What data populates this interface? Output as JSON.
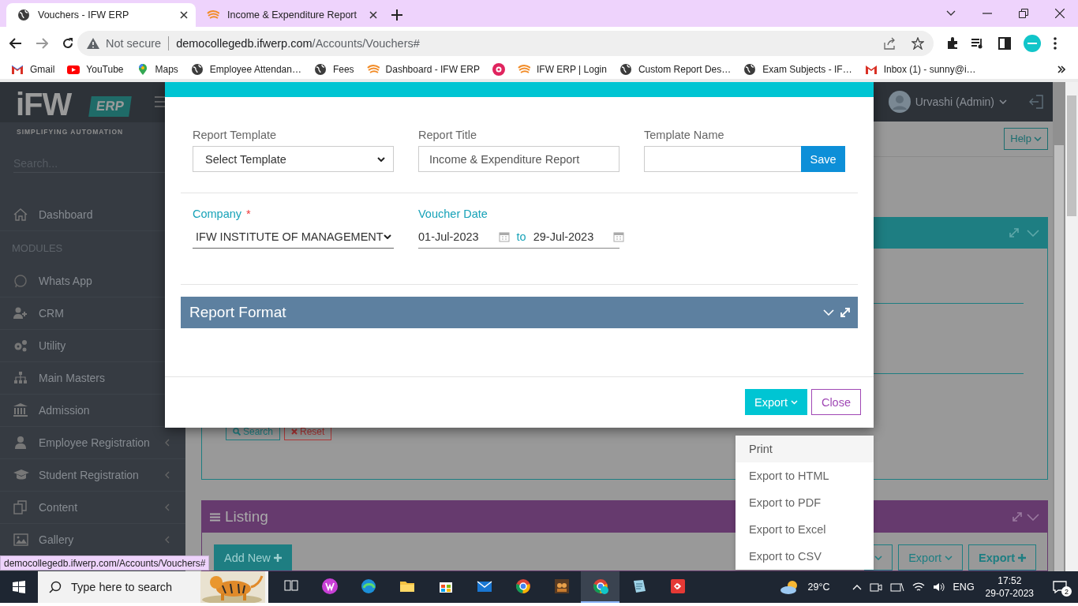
{
  "browser": {
    "tabs": [
      {
        "title": "Vouchers - IFW ERP",
        "selected": true
      },
      {
        "title": "Income & Expenditure Report",
        "selected": false
      }
    ],
    "address": {
      "security": "Not secure",
      "host": "democollegedb.ifwerp.com",
      "path": "/Accounts/Vouchers#"
    },
    "bookmarks": [
      {
        "kind": "link",
        "label": "Gmail"
      },
      {
        "kind": "link",
        "label": "YouTube"
      },
      {
        "kind": "link",
        "label": "Maps"
      },
      {
        "kind": "link",
        "label": "Employee Attendan…"
      },
      {
        "kind": "link",
        "label": "Fees"
      },
      {
        "kind": "link",
        "label": "Dashboard - IFW ERP"
      },
      {
        "kind": "icon"
      },
      {
        "kind": "link",
        "label": "IFW ERP | Login"
      },
      {
        "kind": "link",
        "label": "Custom Report Des…"
      },
      {
        "kind": "link",
        "label": "Exam Subjects - IF…"
      },
      {
        "kind": "link",
        "label": "Inbox (1) - sunny@i…"
      }
    ],
    "status_url": "democollegedb.ifwerp.com/Accounts/Vouchers#"
  },
  "app": {
    "logo": {
      "mark": "iFW",
      "badge": "ERP",
      "tagline": "SIMPLIFYING AUTOMATION"
    },
    "sidebar": {
      "search_placeholder": "Search...",
      "items": [
        {
          "kind": "item",
          "label": "Dashboard"
        },
        {
          "kind": "heading",
          "label": "MODULES"
        },
        {
          "kind": "item",
          "label": "Whats App"
        },
        {
          "kind": "item",
          "label": "CRM"
        },
        {
          "kind": "item",
          "label": "Utility"
        },
        {
          "kind": "item",
          "label": "Main Masters"
        },
        {
          "kind": "item",
          "label": "Admission"
        },
        {
          "kind": "item",
          "label": "Employee Registration",
          "has_submenu": true
        },
        {
          "kind": "item",
          "label": "Student Registration",
          "has_submenu": true
        },
        {
          "kind": "item",
          "label": "Content",
          "has_submenu": true
        },
        {
          "kind": "item",
          "label": "Gallery",
          "has_submenu": true
        }
      ]
    },
    "header": {
      "user": "Urvashi (Admin)"
    },
    "help_button": "Help",
    "filter_panel": {
      "buttons": [
        {
          "kind": "search",
          "label": "Search"
        },
        {
          "kind": "reset",
          "label": "Reset"
        }
      ]
    },
    "listing": {
      "title": "Listing",
      "buttons": [
        {
          "kind": "add",
          "label": "Add New"
        },
        {
          "kind": "more"
        },
        {
          "kind": "export",
          "label": "Export"
        },
        {
          "kind": "export_plus",
          "label": "Export"
        }
      ]
    }
  },
  "modal": {
    "row1": [
      {
        "kind": "select",
        "label": "Report Template",
        "value": "Select Template"
      },
      {
        "kind": "text",
        "label": "Report Title",
        "value": "Income & Expenditure Report"
      },
      {
        "kind": "text_save",
        "label": "Template Name",
        "button": "Save"
      }
    ],
    "company": {
      "label": "Company",
      "required_mark": "*",
      "value": "IFW INSTITUTE OF MANAGEMENT"
    },
    "voucher_date": {
      "label": "Voucher Date",
      "from": "01-Jul-2023",
      "separator": "to",
      "to": "29-Jul-2023"
    },
    "section": {
      "title": "Report Format"
    },
    "buttons": [
      {
        "kind": "dropdown",
        "label": "Export"
      },
      {
        "kind": "outline",
        "label": "Close"
      }
    ],
    "export_menu": [
      {
        "label": "Print",
        "selected": true
      },
      {
        "label": "Export to HTML",
        "selected": false
      },
      {
        "label": "Export to PDF",
        "selected": false
      },
      {
        "label": "Export to Excel",
        "selected": false
      },
      {
        "label": "Export to CSV",
        "selected": false
      }
    ]
  },
  "taskbar": {
    "search_placeholder": "Type here to search",
    "apps": [
      {
        "selected": false
      },
      {
        "selected": false
      },
      {
        "selected": false
      },
      {
        "selected": false
      },
      {
        "selected": false
      },
      {
        "selected": false
      },
      {
        "selected": false
      },
      {
        "selected": false
      },
      {
        "selected": true
      },
      {
        "selected": false
      },
      {
        "selected": false
      }
    ],
    "weather": "29°C",
    "language": "ENG",
    "time": "17:52",
    "date": "29-07-2023",
    "notifications": "2"
  }
}
